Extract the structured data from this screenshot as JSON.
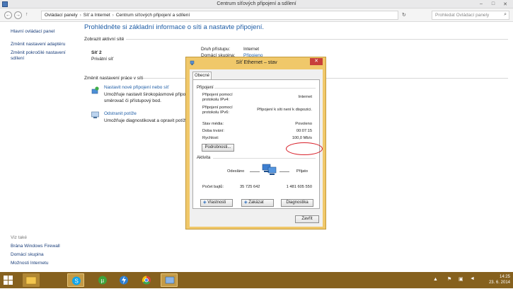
{
  "window": {
    "title": "Centrum síťových připojení a sdílení"
  },
  "address": {
    "crumbs": [
      "Ovládací panely",
      "Síť a Internet",
      "Centrum síťových připojení a sdílení"
    ],
    "search_placeholder": "Prohledat Ovládací panely"
  },
  "sidebar": {
    "top_links": [
      "Hlavní ovládací panel",
      "Změnit nastavení adaptéru",
      "Změnit pokročilé nastavení",
      "sdílení"
    ],
    "see_also_label": "Viz také",
    "bottom_links": [
      "Brána Windows Firewall",
      "Domácí skupina",
      "Možnosti Internetu"
    ]
  },
  "main": {
    "heading": "Prohlédněte si základní informace o síti a nastavte připojení.",
    "active_networks_label": "Zobrazit aktivní sítě",
    "network_name": "Síť 2",
    "network_type": "Privátní síť",
    "access_type_label": "Druh přístupu:",
    "access_type_value": "Internet",
    "homegroup_label": "Domácí skupina:",
    "homegroup_value": "Připojeno",
    "change_settings_label": "Změnit nastavení práce v síti",
    "setup_link": "Nastavit nové připojení nebo síť",
    "setup_desc_1": "Umožňuje nastavit širokopásmové připojení, vytáčené připojení nebo připojení VPN nebo",
    "setup_desc_2": "směrovač či přístupový bod.",
    "troubleshoot_link": "Odstranit potíže",
    "troubleshoot_desc": "Umožňuje diagnostikovat a opravit potíže se sítí nebo získat informace o odstraňování potíží."
  },
  "dialog": {
    "title": "Síť Ethernet – stav",
    "close": "✕",
    "tab": "Obecné",
    "connection_group": "Připojení",
    "ipv4_label_1": "Připojení pomocí",
    "ipv4_label_2": "protokolu IPv4:",
    "ipv4_value": "Internet",
    "ipv6_label_1": "Připojení pomocí",
    "ipv6_label_2": "protokolu IPv6:",
    "ipv6_value": "Připojení k síti není k dispozici.",
    "media_label": "Stav média:",
    "media_value": "Povoleno",
    "duration_label": "Doba trvání:",
    "duration_value": "00:07:15",
    "speed_label": "Rychlost:",
    "speed_value": "100,0 Mb/s",
    "details_button": "Podrobnosti...",
    "activity_group": "Aktivita",
    "sent_label": "Odesláno",
    "received_label": "Přijato",
    "bytes_label": "Počet bajtů:",
    "bytes_sent": "35 725 642",
    "bytes_received": "1 481 605 550",
    "properties_button": "Vlastnosti",
    "disable_button": "Zakázat",
    "diagnose_button": "Diagnostika",
    "close_button": "Zavřít"
  },
  "taskbar": {
    "time": "14:25",
    "date": "23. 6. 2014"
  },
  "colors": {
    "link": "#1e5da6",
    "dialog_frame": "#f0c86a",
    "taskbar": "#86611e",
    "annotation": "#d8202a"
  }
}
